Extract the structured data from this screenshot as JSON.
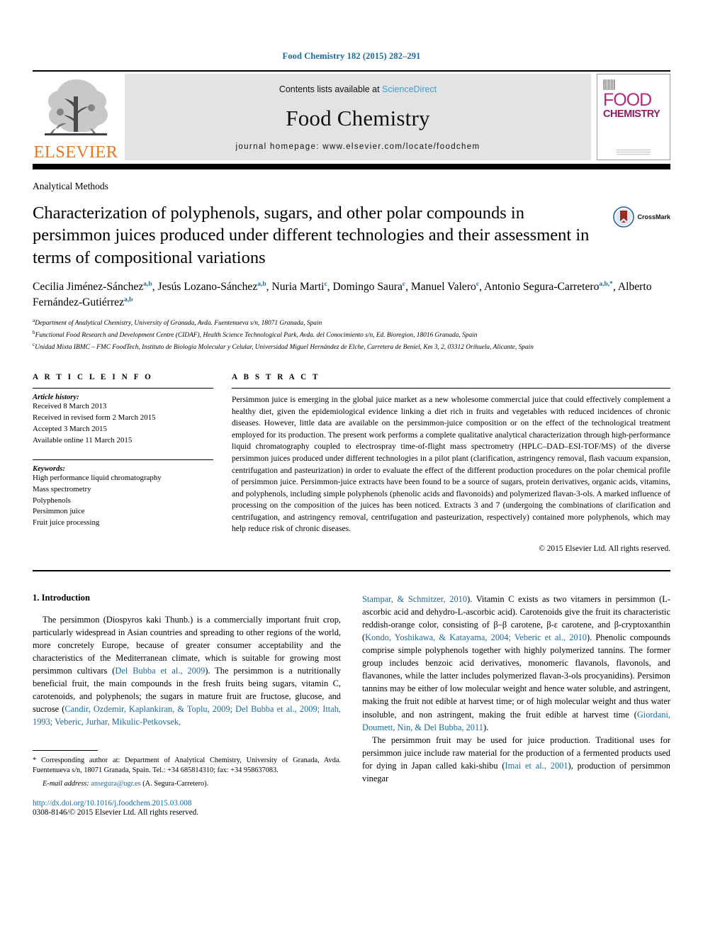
{
  "running_head": "Food Chemistry 182 (2015) 282–291",
  "masthead": {
    "publisher_name": "ELSEVIER",
    "contents_prefix": "Contents lists available at ",
    "contents_link": "ScienceDirect",
    "journal_title": "Food Chemistry",
    "homepage_label": "journal homepage: www.elsevier.com/locate/foodchem",
    "cover": {
      "line1": "FOOD",
      "line2": "CHEMISTRY"
    }
  },
  "section_label": "Analytical Methods",
  "title": "Characterization of polyphenols, sugars, and other polar compounds in persimmon juices produced under different technologies and their assessment in terms of compositional variations",
  "crossmark_label": "CrossMark",
  "authors_line1": "Cecilia Jiménez-Sánchez",
  "authors": [
    {
      "name": "Cecilia Jiménez-Sánchez",
      "sup": "a,b"
    },
    {
      "name": "Jesús Lozano-Sánchez",
      "sup": "a,b"
    },
    {
      "name": "Nuria Marti",
      "sup": "c"
    },
    {
      "name": "Domingo Saura",
      "sup": "c"
    },
    {
      "name": "Manuel Valero",
      "sup": "c"
    },
    {
      "name": "Antonio Segura-Carretero",
      "sup": "a,b,*"
    },
    {
      "name": "Alberto Fernández-Gutiérrez",
      "sup": "a,b"
    }
  ],
  "affiliations": [
    {
      "marker": "a",
      "text": "Department of Analytical Chemistry, University of Granada, Avda. Fuentenueva s/n, 18071 Granada, Spain"
    },
    {
      "marker": "b",
      "text": "Functional Food Research and Development Centre (CIDAF), Health Science Technological Park, Avda. del Conocimiento s/n, Ed. Bioregion, 18016 Granada, Spain"
    },
    {
      "marker": "c",
      "text": "Unidad Mixta IBMC – FMC FoodTech, Instituto de Biología Molecular y Celular, Universidad Miguel Hernández de Elche, Carretera de Beniel, Km 3, 2, 03312 Orihuela, Alicante, Spain"
    }
  ],
  "article_info": {
    "heading": "A R T I C L E   I N F O",
    "history_label": "Article history:",
    "history": [
      "Received 8 March 2013",
      "Received in revised form 2 March 2015",
      "Accepted 3 March 2015",
      "Available online 11 March 2015"
    ],
    "keywords_label": "Keywords:",
    "keywords": [
      "High performance liquid chromatography",
      "Mass spectrometry",
      "Polyphenols",
      "Persimmon juice",
      "Fruit juice processing"
    ]
  },
  "abstract": {
    "heading": "A B S T R A C T",
    "text": "Persimmon juice is emerging in the global juice market as a new wholesome commercial juice that could effectively complement a healthy diet, given the epidemiological evidence linking a diet rich in fruits and vegetables with reduced incidences of chronic diseases. However, little data are available on the persimmon-juice composition or on the effect of the technological treatment employed for its production. The present work performs a complete qualitative analytical characterization through high-performance liquid chromatography coupled to electrospray time-of-flight mass spectrometry (HPLC–DAD–ESI-TOF/MS) of the diverse persimmon juices produced under different technologies in a pilot plant (clarification, astringency removal, flash vacuum expansion, centrifugation and pasteurization) in order to evaluate the effect of the different production procedures on the polar chemical profile of persimmon juice. Persimmon-juice extracts have been found to be a source of sugars, protein derivatives, organic acids, vitamins, and polyphenols, including simple polyphenols (phenolic acids and flavonoids) and polymerized flavan-3-ols. A marked influence of processing on the composition of the juices has been noticed. Extracts 3 and 7 (undergoing the combinations of clarification and centrifugation, and astringency removal, centrifugation and pasteurization, respectively) contained more polyphenols, which may help reduce risk of chronic diseases.",
    "copyright": "© 2015 Elsevier Ltd. All rights reserved."
  },
  "introduction": {
    "heading": "1. Introduction",
    "left_para_a": "The persimmon (Diospyros kaki Thunb.) is a commercially important fruit crop, particularly widespread in Asian countries and spreading to other regions of the world, more concretely Europe, because of greater consumer acceptability and the characteristics of the Mediterranean climate, which is suitable for growing most persimmon cultivars (",
    "left_cite_1": "Del Bubba et al., 2009",
    "left_para_b": "). The persimmon is a nutritionally beneficial fruit, the main compounds in the fresh fruits being sugars, vitamin C, carotenoids, and polyphenols; the sugars in mature fruit are fructose, glucose, and sucrose (",
    "left_cite_2": "Candir, Ozdemir, Kaplankiran, & Toplu, 2009; Del Bubba et al., 2009; Ittah, 1993; Veberic, Jurhar, Mikulic-Petkovsek,",
    "right_cite_1": "Stampar, & Schmitzer, 2010",
    "right_para_a": "). Vitamin C exists as two vitamers in persimmon (L-ascorbic acid and dehydro-L-ascorbic acid). Carotenoids give the fruit its characteristic reddish-orange color, consisting of β–β carotene, β-ε carotene, and β-cryptoxanthin (",
    "right_cite_2": "Kondo, Yoshikawa, & Katayama, 2004; Veberic et al., 2010",
    "right_para_b": "). Phenolic compounds comprise simple polyphenols together with highly polymerized tannins. The former group includes benzoic acid derivatives, monomeric flavanols, flavonols, and flavanones, while the latter includes polymerized flavan-3-ols procyanidins). Persimon tannins may be either of low molecular weight and hence water soluble, and astringent, making the fruit not edible at harvest time; or of high molecular weight and thus water insoluble, and non astringent, making the fruit edible at harvest time (",
    "right_cite_3": "Giordani, Doumett, Nin, & Del Bubba, 2011",
    "right_para_c": ").",
    "right_para_d": "The persimmon fruit may be used for juice production. Traditional uses for persimmon juice include raw material for the production of a fermented products used for dying in Japan called kaki-shibu (",
    "right_cite_4": "Imai et al., 2001",
    "right_para_e": "), production of persimmon vinegar"
  },
  "footnote": {
    "corresponding": "* Corresponding author at: Department of Analytical Chemistry, University of Granada, Avda. Fuentenueva s/n, 18071 Granada, Spain. Tel.: +34 685814310; fax: +34 958637083.",
    "email_label": "E-mail address:",
    "email": "ansegura@ugr.es",
    "email_owner": "(A. Segura-Carretero)."
  },
  "footer": {
    "doi": "http://dx.doi.org/10.1016/j.foodchem.2015.03.008",
    "issn": "0308-8146/© 2015 Elsevier Ltd. All rights reserved."
  },
  "colors": {
    "link": "#1a6ba0",
    "sciencedirect": "#3c9fd6",
    "elsevier_orange": "#E87722",
    "cover_magenta": "#b5297e"
  }
}
